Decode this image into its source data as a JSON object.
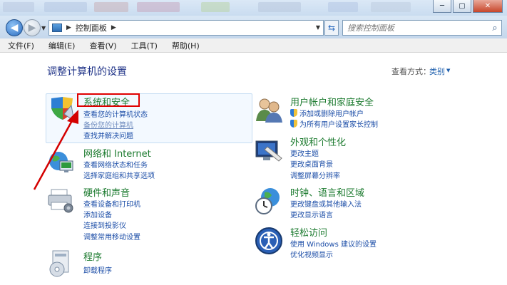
{
  "window": {
    "controls": {
      "minimize": "─",
      "maximize": "▢",
      "close": "✕"
    }
  },
  "address": {
    "crumb": "控制面板",
    "search_placeholder": "搜索控制面板"
  },
  "menu": [
    "文件(F)",
    "编辑(E)",
    "查看(V)",
    "工具(T)",
    "帮助(H)"
  ],
  "page": {
    "title": "调整计算机的设置",
    "view_by_label": "查看方式：",
    "view_by_value": "类别"
  },
  "categories": {
    "security": {
      "title": "系统和安全",
      "links": [
        "查看您的计算机状态",
        "备份您的计算机",
        "查找并解决问题"
      ]
    },
    "network": {
      "title": "网络和 Internet",
      "links": [
        "查看网络状态和任务",
        "选择家庭组和共享选项"
      ]
    },
    "hardware": {
      "title": "硬件和声音",
      "links": [
        "查看设备和打印机",
        "添加设备",
        "连接到投影仪",
        "调整常用移动设置"
      ]
    },
    "programs": {
      "title": "程序",
      "links": [
        "卸载程序"
      ]
    },
    "users": {
      "title": "用户帐户和家庭安全",
      "links": [
        "添加或删除用户帐户",
        "为所有用户设置家长控制"
      ]
    },
    "appearance": {
      "title": "外观和个性化",
      "links": [
        "更改主题",
        "更改桌面背景",
        "调整屏幕分辨率"
      ]
    },
    "clock": {
      "title": "时钟、语言和区域",
      "links": [
        "更改键盘或其他输入法",
        "更改显示语言"
      ]
    },
    "ease": {
      "title": "轻松访问",
      "links": [
        "使用 Windows 建议的设置",
        "优化视频显示"
      ]
    }
  },
  "colors": {
    "accent": "#1e4fa8",
    "category_title": "#1b7a2e",
    "highlight_box": "#e00000"
  }
}
